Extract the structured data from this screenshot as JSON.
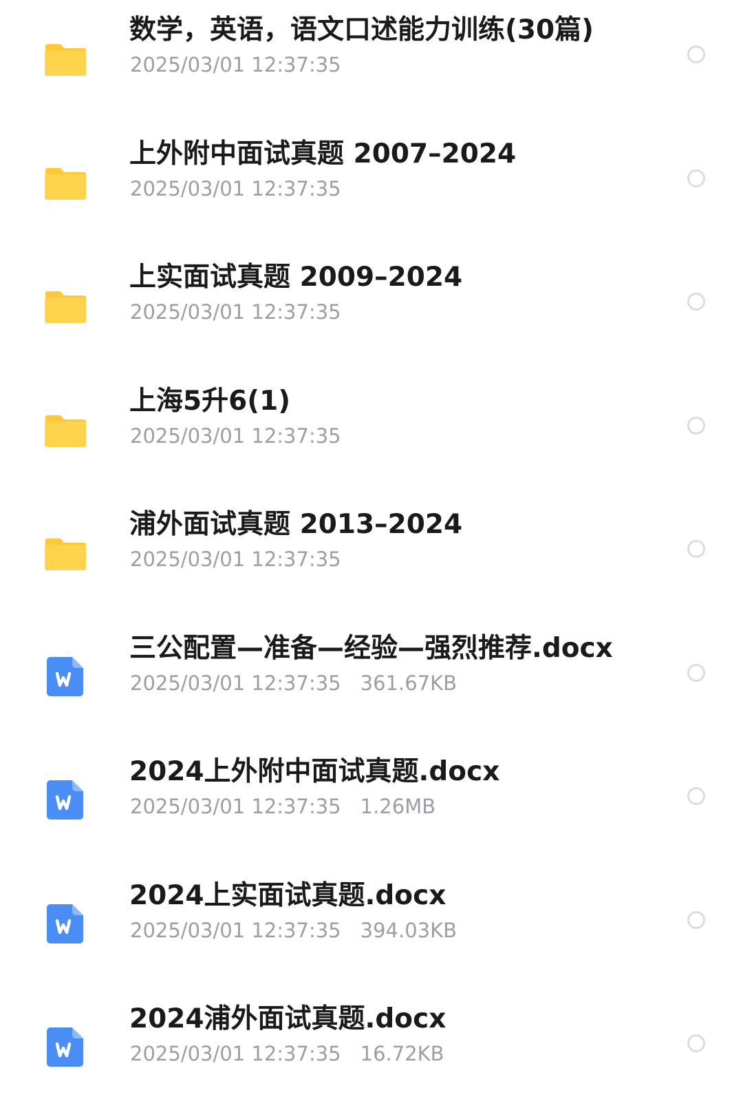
{
  "colors": {
    "folder": "#ffd44d",
    "folder_tab": "#ffc83a",
    "word_icon": "#4a8df5",
    "title_text": "#1a1a1a",
    "meta_text": "#9b9ea5",
    "radio_border": "#dcdcde"
  },
  "files": [
    {
      "type": "folder",
      "icon": "folder-icon",
      "name": "数学，英语，语文口述能力训练(30篇)",
      "date": "2025/03/01 12:37:35",
      "size": ""
    },
    {
      "type": "folder",
      "icon": "folder-icon",
      "name": "上外附中面试真题 2007–2024",
      "date": "2025/03/01 12:37:35",
      "size": ""
    },
    {
      "type": "folder",
      "icon": "folder-icon",
      "name": "上实面试真题 2009–2024",
      "date": "2025/03/01 12:37:35",
      "size": ""
    },
    {
      "type": "folder",
      "icon": "folder-icon",
      "name": "上海5升6(1)",
      "date": "2025/03/01 12:37:35",
      "size": ""
    },
    {
      "type": "folder",
      "icon": "folder-icon",
      "name": "浦外面试真题 2013–2024",
      "date": "2025/03/01 12:37:35",
      "size": ""
    },
    {
      "type": "docx",
      "icon": "word-doc-icon",
      "name": "三公配置—准备—经验—强烈推荐.docx",
      "date": "2025/03/01 12:37:35",
      "size": "361.67KB"
    },
    {
      "type": "docx",
      "icon": "word-doc-icon",
      "name": "2024上外附中面试真题.docx",
      "date": "2025/03/01 12:37:35",
      "size": "1.26MB"
    },
    {
      "type": "docx",
      "icon": "word-doc-icon",
      "name": "2024上实面试真题.docx",
      "date": "2025/03/01 12:37:35",
      "size": "394.03KB"
    },
    {
      "type": "docx",
      "icon": "word-doc-icon",
      "name": "2024浦外面试真题.docx",
      "date": "2025/03/01 12:37:35",
      "size": "16.72KB"
    }
  ]
}
